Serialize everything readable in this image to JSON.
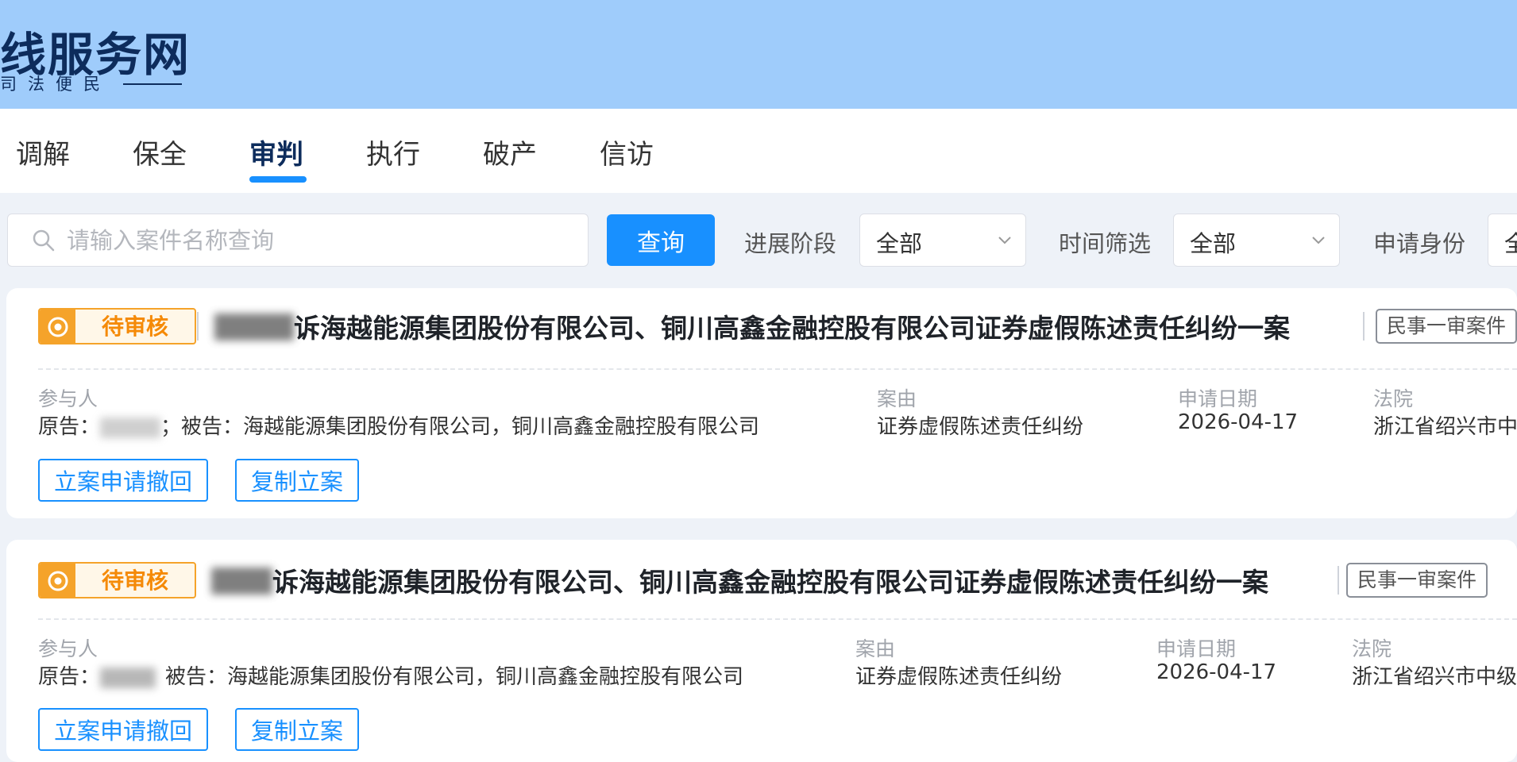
{
  "header": {
    "site_title": "线服务网",
    "slogan": "司法便民"
  },
  "tabs": [
    {
      "label": "调解"
    },
    {
      "label": "保全"
    },
    {
      "label": "审判",
      "active": true
    },
    {
      "label": "执行"
    },
    {
      "label": "破产"
    },
    {
      "label": "信访"
    }
  ],
  "filters": {
    "search_placeholder": "请输入案件名称查询",
    "search_value": "",
    "query_label": "查询",
    "stage_label": "进展阶段",
    "stage_value": "全部",
    "time_label": "时间筛选",
    "time_value": "全部",
    "identity_label": "申请身份",
    "identity_value": "全"
  },
  "colors": {
    "header_bg": "#9fccfb",
    "accent": "#1890ff",
    "pending": "#f5a32a"
  },
  "cards": [
    {
      "status": "待审核",
      "title": "诉海越能源集团股份有限公司、铜川高鑫金融控股有限公司证券虚假陈述责任纠纷一案",
      "case_type": "民事一审案件",
      "participants_label": "参与人",
      "plaintiff_prefix": "原告：",
      "plaintiff_suffix": "；",
      "defendant_prefix": "被告：",
      "defendants": "海越能源集团股份有限公司，铜川高鑫金融控股有限公司",
      "cause_label": "案由",
      "cause": "证券虚假陈述责任纠纷",
      "date_label": "申请日期",
      "date": "2026-04-17",
      "court_label": "法院",
      "court": "浙江省绍兴市中",
      "actions": [
        "立案申请撤回",
        "复制立案"
      ]
    },
    {
      "status": "待审核",
      "title": "诉海越能源集团股份有限公司、铜川高鑫金融控股有限公司证券虚假陈述责任纠纷一案",
      "case_type": "民事一审案件",
      "participants_label": "参与人",
      "plaintiff_prefix": "原告：",
      "defendant_prefix": "被告：",
      "defendants": "海越能源集团股份有限公司，铜川高鑫金融控股有限公司",
      "cause_label": "案由",
      "cause": "证券虚假陈述责任纠纷",
      "date_label": "申请日期",
      "date": "2026-04-17",
      "court_label": "法院",
      "court": "浙江省绍兴市中级",
      "actions": [
        "立案申请撤回",
        "复制立案"
      ]
    }
  ]
}
